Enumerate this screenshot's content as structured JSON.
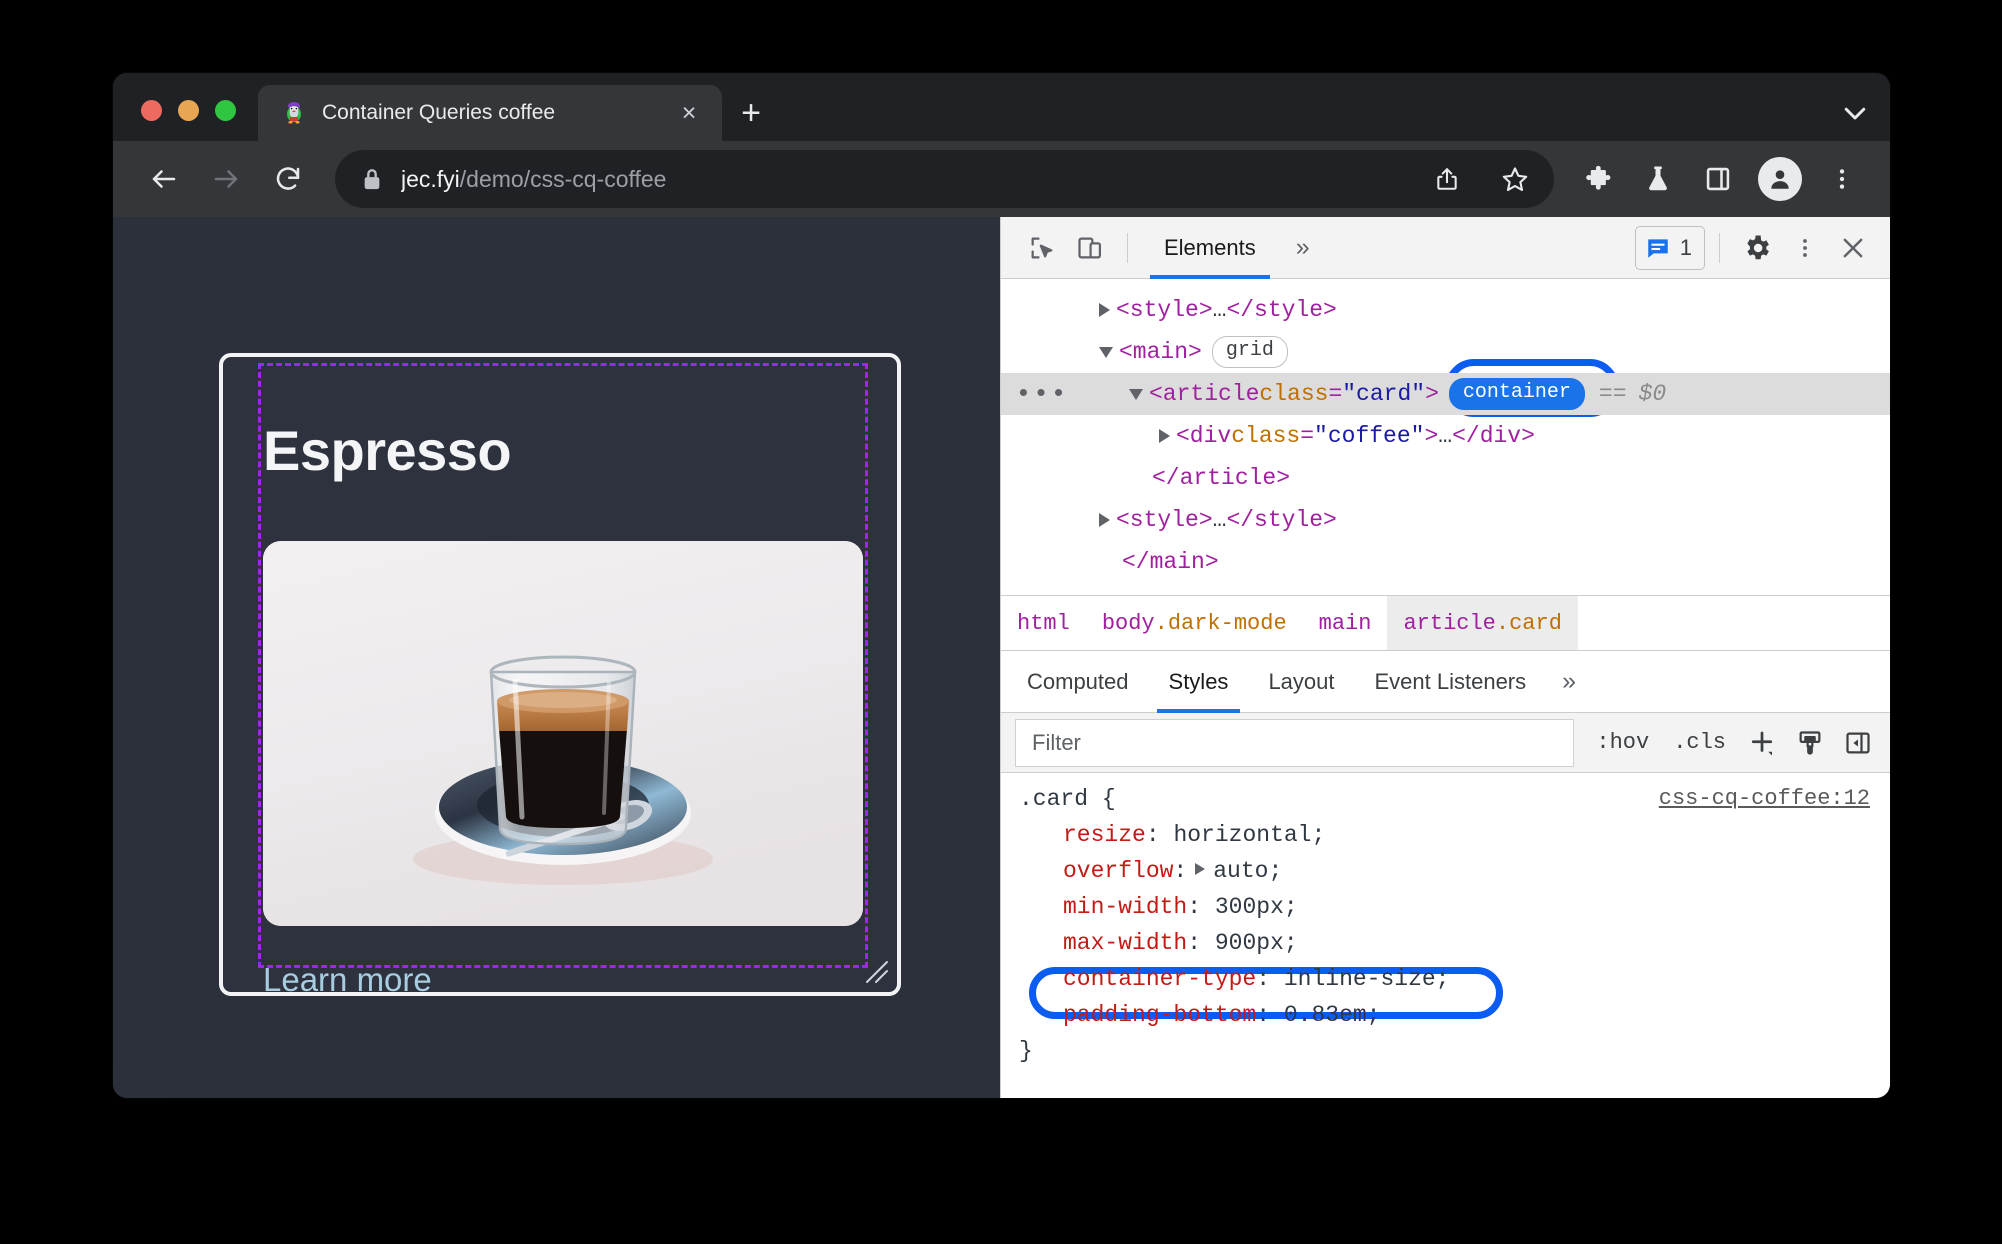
{
  "browser": {
    "tab": {
      "title": "Container Queries coffee",
      "favicon": "penguin-favicon",
      "close_label": "×"
    },
    "new_tab_label": "+",
    "toolbar": {
      "back_icon": "back-arrow-icon",
      "forward_icon": "forward-arrow-icon",
      "reload_icon": "reload-icon",
      "lock_icon": "lock-icon",
      "url_host": "jec.fyi",
      "url_path": "/demo/css-cq-coffee",
      "share_icon": "share-icon",
      "bookmark_icon": "star-icon",
      "extensions_icon": "puzzle-icon",
      "experiments_icon": "flask-icon",
      "side_panel_icon": "side-panel-icon",
      "profile_icon": "profile-avatar-icon",
      "menu_icon": "three-dot-menu-icon"
    }
  },
  "page": {
    "card_title": "Espresso",
    "image_alt": "espresso-glass-on-saucer",
    "link_label": "Learn more",
    "resize_handle": "resize-handle"
  },
  "devtools": {
    "topbar": {
      "inspect_icon": "inspect-element-icon",
      "device_toggle_icon": "device-toolbar-icon",
      "active_panel": "Elements",
      "overflow_label": "»",
      "message_count": "1",
      "message_icon": "message-badge-icon",
      "settings_icon": "gear-icon",
      "more_icon": "three-dot-menu-icon",
      "close_icon": "close-icon"
    },
    "dom_tree": [
      {
        "indent": 1,
        "toggle": "closed",
        "selected": false,
        "dots": false,
        "parts": [
          {
            "t": "tag",
            "v": "<style>"
          },
          {
            "t": "ellip",
            "v": "…"
          },
          {
            "t": "tag",
            "v": "</style>"
          }
        ]
      },
      {
        "indent": 1,
        "toggle": "open",
        "selected": false,
        "dots": false,
        "parts": [
          {
            "t": "tag",
            "v": "<main>"
          },
          {
            "t": "badge",
            "v": "grid"
          }
        ]
      },
      {
        "indent": 2,
        "toggle": "open",
        "selected": true,
        "dots": true,
        "parts": [
          {
            "t": "tag",
            "v": "<article "
          },
          {
            "t": "attr-name",
            "v": "class"
          },
          {
            "t": "tag",
            "v": "="
          },
          {
            "t": "attr-val",
            "v": "\"card\""
          },
          {
            "t": "tag",
            "v": ">"
          },
          {
            "t": "badge-on",
            "v": "container"
          },
          {
            "t": "eq",
            "v": "=="
          },
          {
            "t": "dollar",
            "v": "$0"
          }
        ]
      },
      {
        "indent": 3,
        "toggle": "closed",
        "selected": false,
        "dots": false,
        "parts": [
          {
            "t": "tag",
            "v": "<div "
          },
          {
            "t": "attr-name",
            "v": "class"
          },
          {
            "t": "tag",
            "v": "="
          },
          {
            "t": "attr-val",
            "v": "\"coffee\""
          },
          {
            "t": "tag",
            "v": ">"
          },
          {
            "t": "ellip",
            "v": "…"
          },
          {
            "t": "tag",
            "v": "</div>"
          }
        ]
      },
      {
        "indent": 2,
        "toggle": "none",
        "selected": false,
        "dots": false,
        "parts": [
          {
            "t": "tag",
            "v": "</article>"
          }
        ]
      },
      {
        "indent": 1,
        "toggle": "closed",
        "selected": false,
        "dots": false,
        "parts": [
          {
            "t": "tag",
            "v": "<style>"
          },
          {
            "t": "ellip",
            "v": "…"
          },
          {
            "t": "tag",
            "v": "</style>"
          }
        ]
      },
      {
        "indent": 1,
        "toggle": "none",
        "selected": false,
        "dots": false,
        "parts": [
          {
            "t": "tag",
            "v": "</main>"
          }
        ]
      }
    ],
    "breadcrumb": [
      {
        "tag": "html",
        "cls": "",
        "selected": false
      },
      {
        "tag": "body",
        "cls": ".dark-mode",
        "selected": false
      },
      {
        "tag": "main",
        "cls": "",
        "selected": false
      },
      {
        "tag": "article",
        "cls": ".card",
        "selected": true
      }
    ],
    "sidebar_tabs": [
      {
        "label": "Computed",
        "active": false
      },
      {
        "label": "Styles",
        "active": true
      },
      {
        "label": "Layout",
        "active": false
      },
      {
        "label": "Event Listeners",
        "active": false
      }
    ],
    "sidebar_overflow": "»",
    "filter_bar": {
      "placeholder": "Filter",
      "value": "",
      "hov_label": ":hov",
      "cls_label": ".cls",
      "new_rule_icon": "plus-icon",
      "style_icon": "paintbrush-icon",
      "toggle_sidebar_icon": "toggle-sidebar-icon"
    },
    "styles": {
      "selector": ".card {",
      "source": "css-cq-coffee:12",
      "close_brace": "}",
      "declarations": [
        {
          "prop": "resize",
          "value": "horizontal;",
          "expandable": false,
          "highlighted": false
        },
        {
          "prop": "overflow",
          "value": "auto;",
          "expandable": true,
          "highlighted": false
        },
        {
          "prop": "min-width",
          "value": "300px;",
          "expandable": false,
          "highlighted": false
        },
        {
          "prop": "max-width",
          "value": "900px;",
          "expandable": false,
          "highlighted": false
        },
        {
          "prop": "container-type",
          "value": "inline-size;",
          "expandable": false,
          "highlighted": true
        },
        {
          "prop": "padding-bottom",
          "value": "0.83em;",
          "expandable": false,
          "highlighted": false
        }
      ]
    }
  },
  "colors": {
    "accent_blue": "#1a73e8",
    "annotation_blue": "#0b5cf0",
    "container_badge": "#1a73e8",
    "page_bg": "#2b303b",
    "card_border": "#f2f3f5",
    "container_outline": "#9c27f0",
    "link_color": "#a8cde0",
    "css_prop": "#c41a16",
    "dom_tag": "#a020a0",
    "dom_attr_name": "#c07000",
    "dom_attr_value": "#1a1aa6"
  }
}
